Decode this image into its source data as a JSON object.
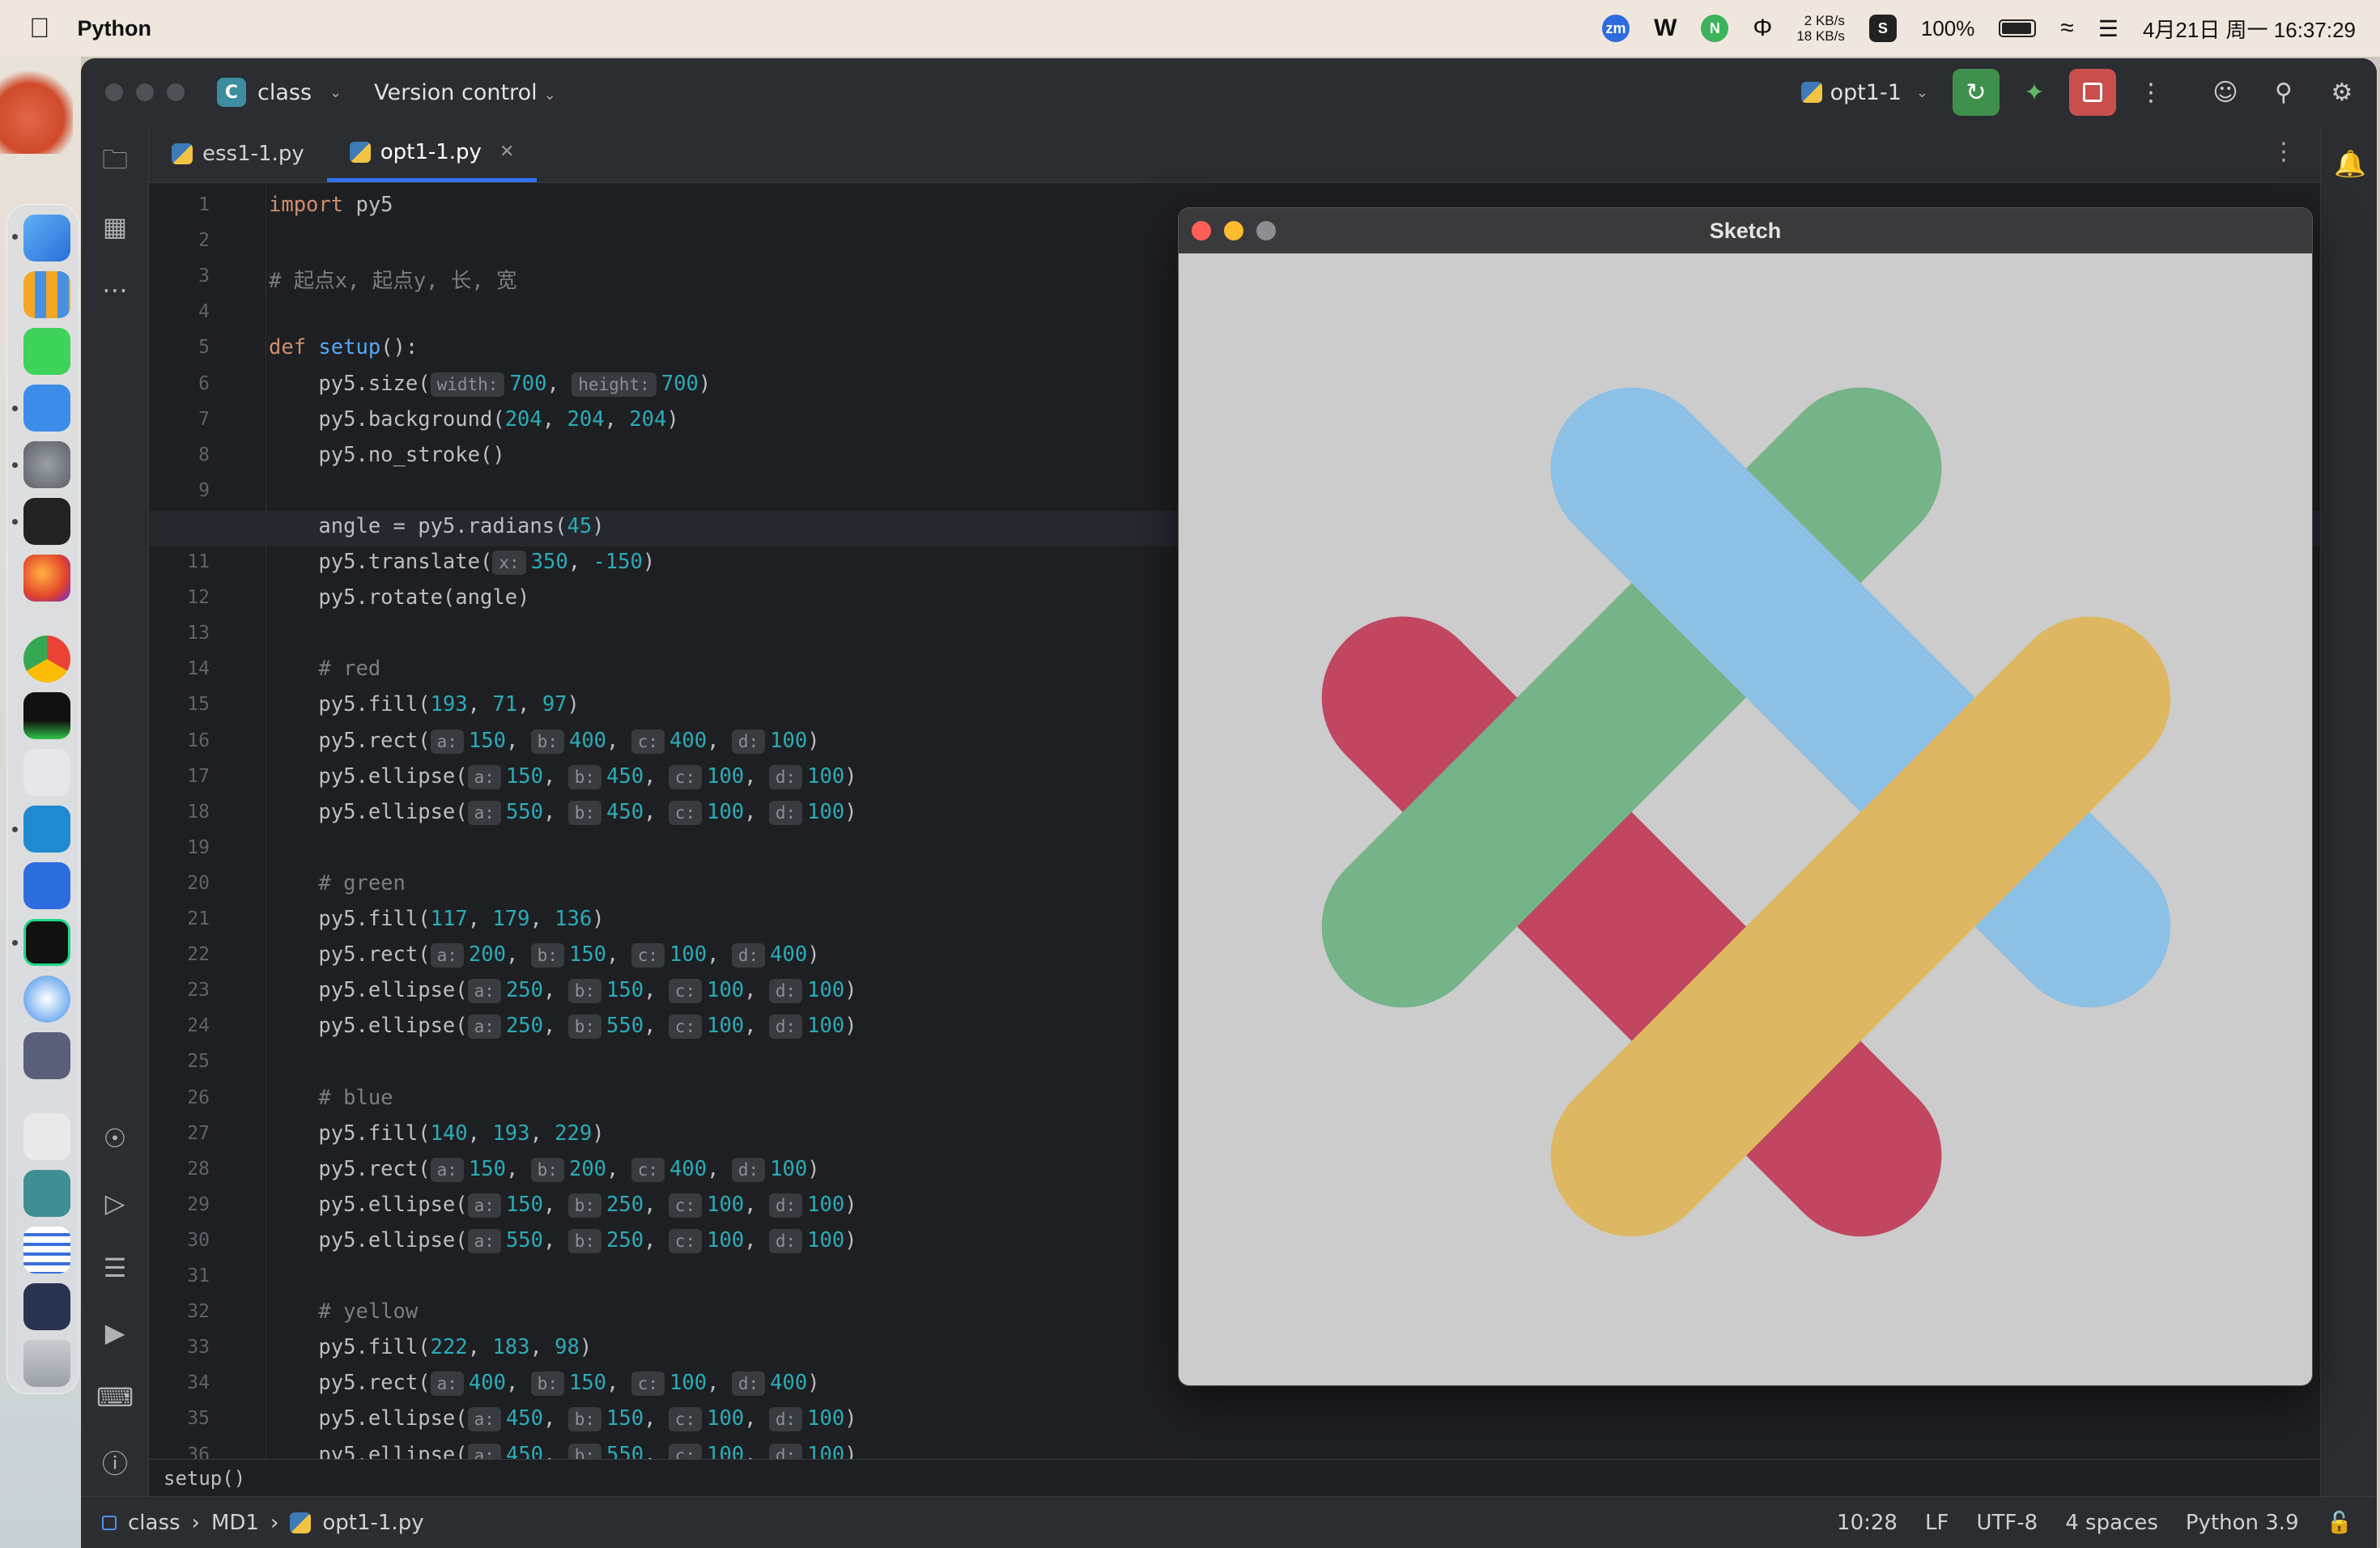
{
  "menubar": {
    "app_name": "Python",
    "net_up": "2 KB/s",
    "net_down": "18 KB/s",
    "battery": "100%",
    "datetime": "4月21日 周一 16:37:29",
    "icons": [
      "zoom-icon",
      "vectorize-icon",
      "nvidia-icon",
      "typewriter-icon",
      "sublime-icon",
      "battery-icon",
      "wifi-icon",
      "control-center-icon"
    ]
  },
  "ide": {
    "project": "class",
    "project_badge": "C",
    "vcs": "Version control",
    "run_config": "opt1-1",
    "tabs": [
      {
        "label": "ess1-1.py",
        "active": false
      },
      {
        "label": "opt1-1.py",
        "active": true
      }
    ],
    "code_lines": [
      "import py5",
      "",
      "# 起点x, 起点y, 长, 宽",
      "",
      "def setup():",
      "    py5.size(width: 700, height: 700)",
      "    py5.background(204, 204, 204)",
      "    py5.no_stroke()",
      "",
      "    angle = py5.radians(45)",
      "    py5.translate(x: 350, -150)",
      "    py5.rotate(angle)",
      "",
      "    # red",
      "    py5.fill(193, 71, 97)",
      "    py5.rect(a: 150, b: 400, c: 400, d: 100)",
      "    py5.ellipse(a: 150, b: 450, c: 100, d: 100)",
      "    py5.ellipse(a: 550, b: 450, c: 100, d: 100)",
      "",
      "    # green",
      "    py5.fill(117, 179, 136)",
      "    py5.rect(a: 200, b: 150, c: 100, d: 400)",
      "    py5.ellipse(a: 250, b: 150, c: 100, d: 100)",
      "    py5.ellipse(a: 250, b: 550, c: 100, d: 100)",
      "",
      "    # blue",
      "    py5.fill(140, 193, 229)",
      "    py5.rect(a: 150, b: 200, c: 400, d: 100)",
      "    py5.ellipse(a: 150, b: 250, c: 100, d: 100)",
      "    py5.ellipse(a: 550, b: 250, c: 100, d: 100)",
      "",
      "    # yellow",
      "    py5.fill(222, 183, 98)",
      "    py5.rect(a: 400, b: 150, c: 100, d: 400)",
      "    py5.ellipse(a: 450, b: 150, c: 100, d: 100)",
      "    py5.ellipse(a: 450, b: 550, c: 100, d: 100)"
    ],
    "current_line": 10,
    "breadcrumb_fn": "setup()",
    "status": {
      "path": [
        "class",
        "MD1",
        "opt1-1.py"
      ],
      "cursor": "10:28",
      "line_sep": "LF",
      "encoding": "UTF-8",
      "indent": "4 spaces",
      "interpreter": "Python 3.9"
    }
  },
  "sketch": {
    "title": "Sketch",
    "background": "#cccccc",
    "colors": {
      "red": "#c14761",
      "green": "#75b388",
      "blue": "#8cc1e5",
      "yellow": "#deb762"
    }
  }
}
